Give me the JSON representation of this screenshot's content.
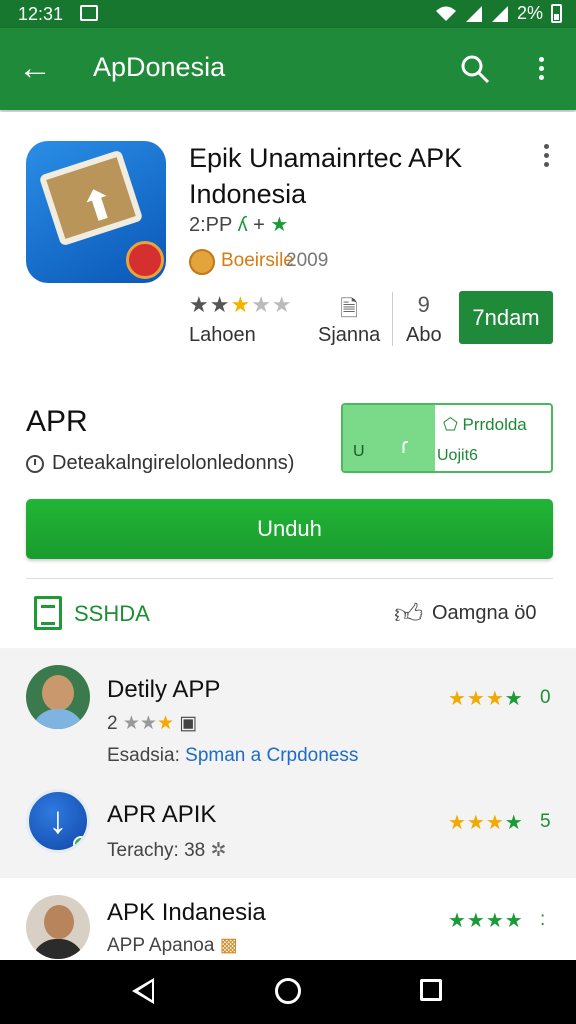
{
  "status_bar": {
    "time": "12:31",
    "battery": "2%"
  },
  "app_bar": {
    "title": "ApDonesia",
    "back_icon": "arrow-back-icon",
    "search_icon": "search-icon",
    "more_icon": "more-vert-icon"
  },
  "app": {
    "title": "Epik Unamainrtec APK Indonesia",
    "rating_line": "2:PP",
    "developer": "Boeirsile",
    "year": "2009",
    "stats": {
      "reviews_label": "Lahoen",
      "size_label": "Sjanna",
      "age_label": "Abo",
      "age_icon": "9"
    },
    "install_label": "7ndam"
  },
  "section": {
    "title": "APR",
    "description": "Deteakalngirelolonledonns)",
    "promo_left": "U",
    "promo_right_top": "Prrdolda",
    "promo_right_bottom": "Uojit6",
    "download_label": "Unduh"
  },
  "tabs": {
    "left_label": "SSHDA",
    "right_label": "Oamgna",
    "right_suffix": "ö0"
  },
  "list": [
    {
      "title": "Detily APP",
      "sub_prefix": "2",
      "sub_extra": "",
      "link_prefix": "Esadsia:",
      "link": "Spman a Crpdoness",
      "score": "0",
      "stars_color": "#f2a900"
    },
    {
      "title": "APR APIK",
      "sub_prefix": "Terachy: 38",
      "link_prefix": "",
      "link": "",
      "score": "5",
      "stars_color": "#f2a900"
    },
    {
      "title": "APK Indanesia",
      "sub_prefix": "APP Apanoa",
      "link_prefix": "",
      "link": "",
      "score": ":",
      "stars_color": "#1a9a38"
    }
  ],
  "nav": {
    "back_icon": "nav-back-icon",
    "home_icon": "nav-home-icon",
    "recents_icon": "nav-recents-icon"
  }
}
